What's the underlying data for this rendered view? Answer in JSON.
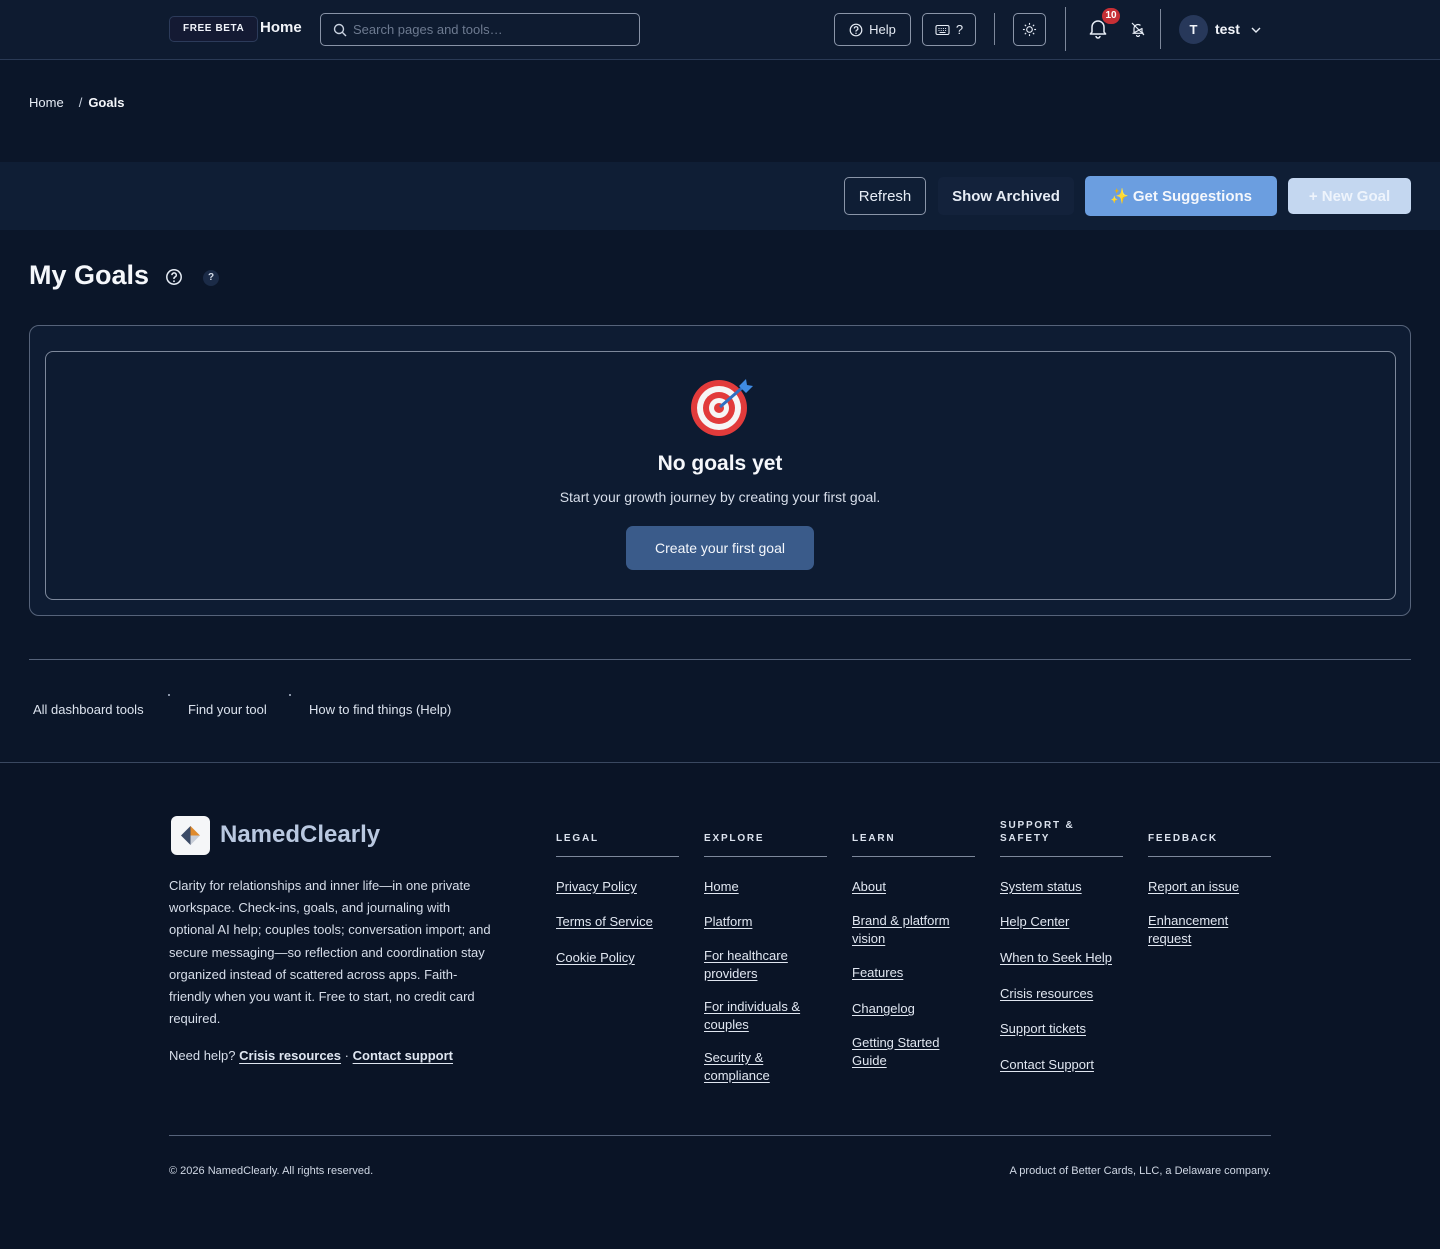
{
  "topbar": {
    "beta_badge": "FREE BETA",
    "home_label": "Home",
    "search_placeholder": "Search pages and tools…",
    "help_label": "Help",
    "shortcuts_label": "?",
    "notification_count": "10",
    "user_initial": "T",
    "user_name": "test"
  },
  "breadcrumb": {
    "home": "Home",
    "separator": "/",
    "current": "Goals"
  },
  "actions": {
    "refresh": "Refresh",
    "show_archived": "Show Archived",
    "suggestions_emoji": "✨",
    "get_suggestions": "Get Suggestions",
    "new_goal": "+ New Goal"
  },
  "page": {
    "title": "My Goals",
    "help_badge": "?"
  },
  "empty_state": {
    "icon": "🎯",
    "title": "No goals yet",
    "text": "Start your growth journey by creating your first goal.",
    "cta": "Create your first goal"
  },
  "quick_links": [
    "All dashboard tools",
    "Find your tool",
    "How to find things (Help)"
  ],
  "footer": {
    "brand": "NamedClearly",
    "description": "Clarity for relationships and inner life—in one private workspace. Check-ins, goals, and journaling with optional AI help; couples tools; conversation import; and secure messaging—so reflection and coordination stay organized instead of scattered across apps. Faith-friendly when you want it. Free to start, no credit card required.",
    "need_help": "Need help?",
    "crisis_link": "Crisis resources",
    "dot": "·",
    "contact_link": "Contact support",
    "columns": [
      {
        "heading": "LEGAL",
        "links": [
          "Privacy Policy",
          "Terms of Service",
          "Cookie Policy"
        ]
      },
      {
        "heading": "EXPLORE",
        "links": [
          "Home",
          "Platform",
          "For healthcare providers",
          "For individuals & couples",
          "Security & compliance"
        ]
      },
      {
        "heading": "LEARN",
        "links": [
          "About",
          "Brand & platform vision",
          "Features",
          "Changelog",
          "Getting Started Guide"
        ]
      },
      {
        "heading": "SUPPORT & SAFETY",
        "links": [
          "System status",
          "Help Center",
          "When to Seek Help",
          "Crisis resources",
          "Support tickets",
          "Contact Support"
        ]
      },
      {
        "heading": "FEEDBACK",
        "links": [
          "Report an issue",
          "Enhancement request"
        ]
      }
    ],
    "copyright": "© 2026 NamedClearly. All rights reserved.",
    "company": "A product of Better Cards, LLC, a Delaware company."
  },
  "colors": {
    "accent": "#6b9ee0",
    "primary_button": "#3a5b8a",
    "badge_red": "#c62f35",
    "background": "#0b1629"
  }
}
